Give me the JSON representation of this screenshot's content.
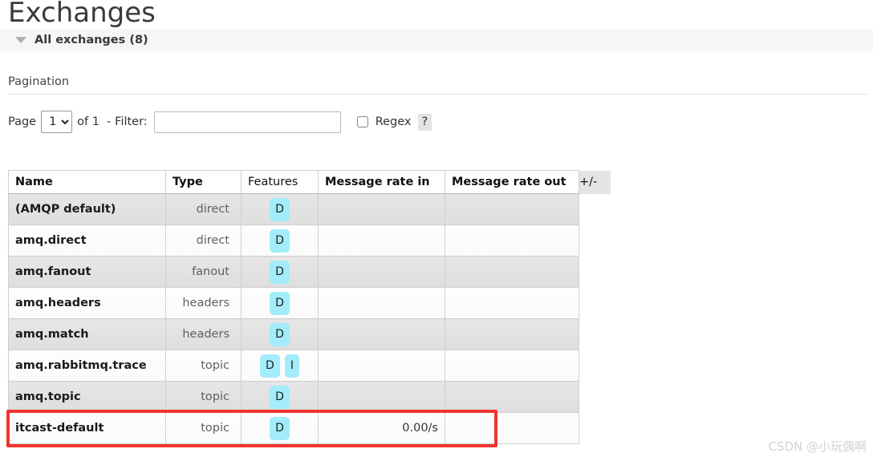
{
  "page": {
    "title": "Exchanges",
    "section": {
      "toggle_icon": "triangle-down-icon",
      "label": "All exchanges (8)"
    }
  },
  "pagination": {
    "heading": "Pagination",
    "page_label": "Page",
    "page_value": "1",
    "page_options": [
      "1"
    ],
    "of_label": "of 1",
    "dash": "-",
    "filter_label": "Filter:",
    "filter_value": "",
    "filter_placeholder": "",
    "regex_label": "Regex",
    "regex_checked": false,
    "help_label": "?"
  },
  "table": {
    "columns": [
      "Name",
      "Type",
      "Features",
      "Message rate in",
      "Message rate out"
    ],
    "plus_minus_label": "+/-",
    "rows": [
      {
        "name": "(AMQP default)",
        "type": "direct",
        "features": [
          "D"
        ],
        "rate_in": "",
        "rate_out": ""
      },
      {
        "name": "amq.direct",
        "type": "direct",
        "features": [
          "D"
        ],
        "rate_in": "",
        "rate_out": ""
      },
      {
        "name": "amq.fanout",
        "type": "fanout",
        "features": [
          "D"
        ],
        "rate_in": "",
        "rate_out": ""
      },
      {
        "name": "amq.headers",
        "type": "headers",
        "features": [
          "D"
        ],
        "rate_in": "",
        "rate_out": ""
      },
      {
        "name": "amq.match",
        "type": "headers",
        "features": [
          "D"
        ],
        "rate_in": "",
        "rate_out": ""
      },
      {
        "name": "amq.rabbitmq.trace",
        "type": "topic",
        "features": [
          "D",
          "I"
        ],
        "rate_in": "",
        "rate_out": ""
      },
      {
        "name": "amq.topic",
        "type": "topic",
        "features": [
          "D"
        ],
        "rate_in": "",
        "rate_out": ""
      },
      {
        "name": "itcast-default",
        "type": "topic",
        "features": [
          "D"
        ],
        "rate_in": "0.00/s",
        "rate_out": ""
      }
    ]
  },
  "annotation": {
    "highlight_color": "#f0342f",
    "highlighted_row": "itcast-default"
  },
  "watermark": {
    "text": "CSDN @小玩偶啊"
  },
  "colors": {
    "badge_bg": "#a3ecfb",
    "section_bg": "#f6f6f6",
    "row_even_bg": "#e2e2e2",
    "row_odd_bg": "#fcfcfc"
  }
}
